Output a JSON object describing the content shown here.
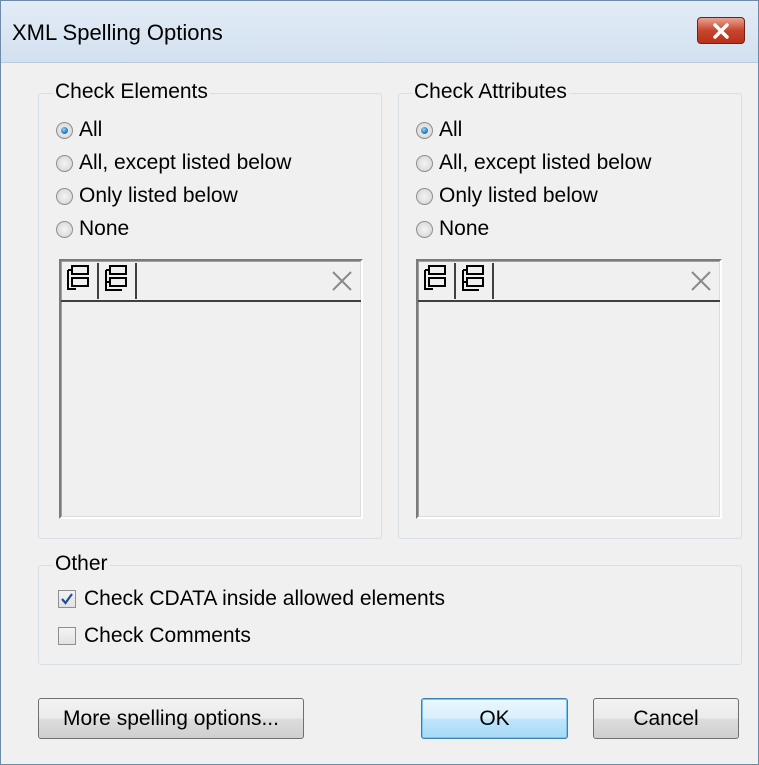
{
  "window": {
    "title": "XML Spelling Options"
  },
  "elements_group": {
    "label": "Check Elements",
    "options": [
      "All",
      "All, except listed below",
      "Only listed below",
      "None"
    ],
    "selected": "All"
  },
  "attributes_group": {
    "label": "Check Attributes",
    "options": [
      "All",
      "All, except listed below",
      "Only listed below",
      "None"
    ],
    "selected": "All"
  },
  "other_group": {
    "label": "Other",
    "check_cdata": {
      "label": "Check CDATA inside allowed elements",
      "checked": true
    },
    "check_comments": {
      "label": "Check Comments",
      "checked": false
    }
  },
  "buttons": {
    "more": "More spelling options...",
    "ok": "OK",
    "cancel": "Cancel"
  },
  "icons": {
    "close": "close-icon",
    "insert": "insert-row-icon",
    "append": "append-row-icon",
    "delete": "delete-icon"
  },
  "colors": {
    "close_button": "#c7452d",
    "radio_selected": "#1d6fb3",
    "check_mark": "#1d4f91"
  }
}
